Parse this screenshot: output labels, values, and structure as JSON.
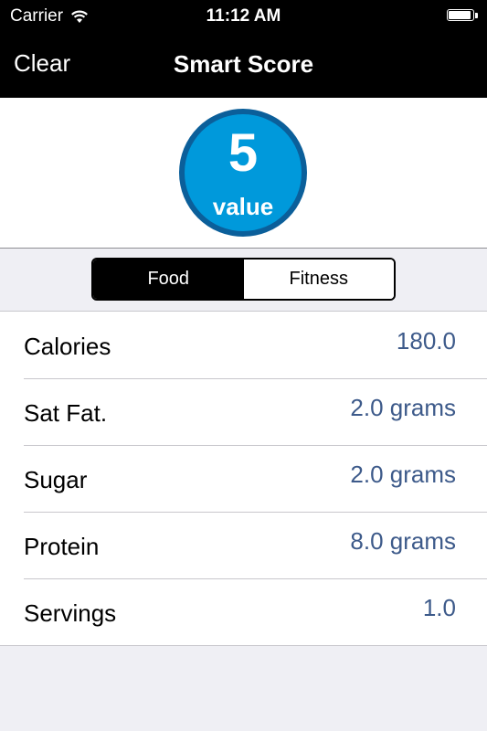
{
  "status_bar": {
    "carrier": "Carrier",
    "time": "11:12 AM"
  },
  "nav": {
    "left_button": "Clear",
    "title": "Smart Score"
  },
  "score": {
    "number": "5",
    "label": "value",
    "colors": {
      "outer": "#0b5f9a",
      "inner": "#0099db"
    }
  },
  "segments": {
    "items": [
      "Food",
      "Fitness"
    ],
    "selected": "Food"
  },
  "rows": [
    {
      "label": "Calories",
      "value": "180.0"
    },
    {
      "label": "Sat Fat.",
      "value": "2.0 grams"
    },
    {
      "label": "Sugar",
      "value": "2.0 grams"
    },
    {
      "label": "Protein",
      "value": "8.0 grams"
    },
    {
      "label": "Servings",
      "value": "1.0"
    }
  ],
  "colors": {
    "bar_background": "#000000",
    "value_text": "#3d5a8a",
    "page_background": "#efeff4"
  }
}
